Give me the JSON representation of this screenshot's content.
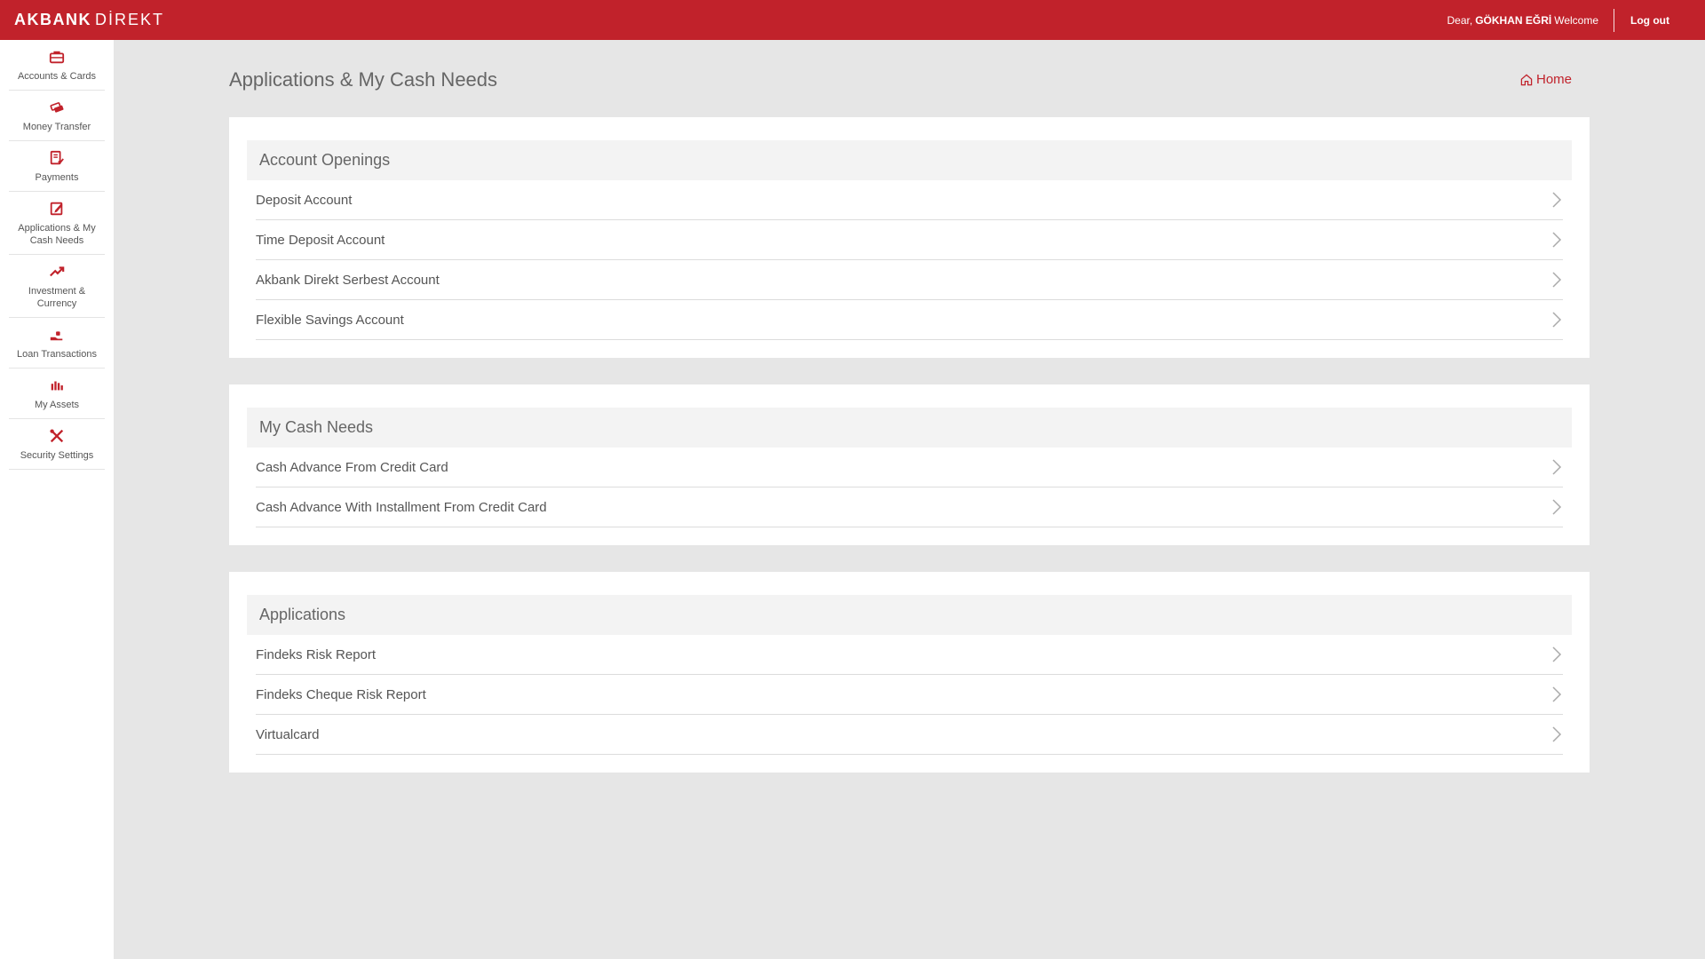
{
  "brand": {
    "bold": "AKBANK",
    "light": "DİREKT"
  },
  "user": {
    "prefix": "Dear,",
    "name": "GÖKHAN EĞRİ",
    "suffix": "Welcome",
    "logout": "Log out"
  },
  "sidebar": {
    "items": [
      {
        "label": "Accounts & Cards",
        "icon": "briefcase-icon"
      },
      {
        "label": "Money Transfer",
        "icon": "money-transfer-icon"
      },
      {
        "label": "Payments",
        "icon": "bill-payment-icon"
      },
      {
        "label": "Applications & My Cash Needs",
        "icon": "edit-document-icon"
      },
      {
        "label": "Investment & Currency",
        "icon": "trending-up-icon"
      },
      {
        "label": "Loan Transactions",
        "icon": "loan-hand-icon"
      },
      {
        "label": "My Assets",
        "icon": "bar-chart-icon"
      },
      {
        "label": "Security Settings",
        "icon": "tools-icon"
      }
    ]
  },
  "page": {
    "title": "Applications & My Cash Needs",
    "home": "Home"
  },
  "sections": [
    {
      "title": "Account Openings",
      "items": [
        "Deposit Account",
        "Time Deposit Account",
        "Akbank Direkt Serbest Account",
        "Flexible Savings Account"
      ]
    },
    {
      "title": "My Cash Needs",
      "items": [
        "Cash Advance From Credit Card",
        "Cash Advance With Installment From Credit Card"
      ]
    },
    {
      "title": "Applications",
      "items": [
        "Findeks Risk Report",
        "Findeks Cheque Risk Report",
        "Virtualcard"
      ]
    }
  ],
  "colors": {
    "brand_red": "#c1222b",
    "background": "#e6e6e6",
    "card": "#ffffff",
    "section_header": "#f3f3f3"
  }
}
